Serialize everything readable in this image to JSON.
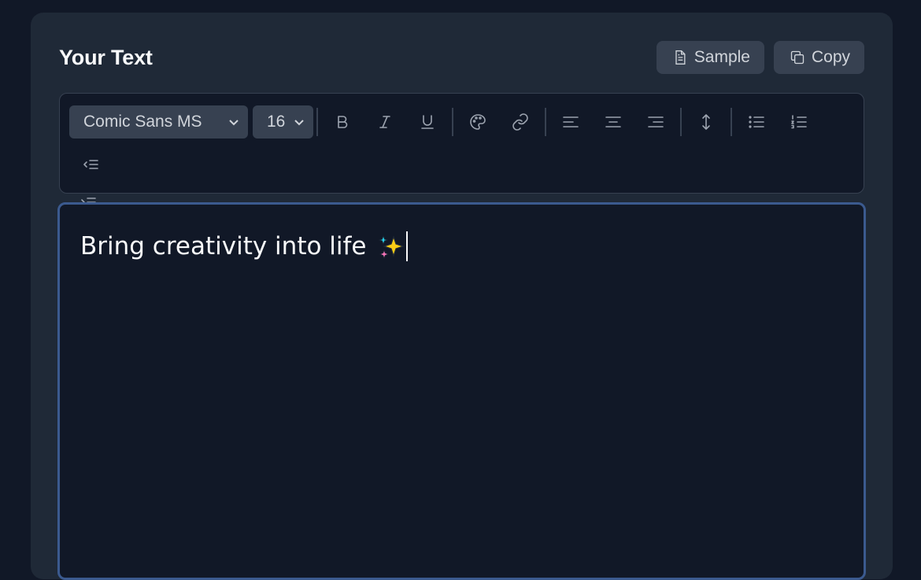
{
  "header": {
    "title": "Your Text",
    "sample_label": "Sample",
    "copy_label": "Copy"
  },
  "toolbar": {
    "font_family": "Comic Sans MS",
    "font_size": "16",
    "buttons": [
      "bold-icon",
      "italic-icon",
      "underline-icon",
      "palette-icon",
      "link-icon",
      "align-left-icon",
      "align-center-icon",
      "align-right-icon",
      "line-height-icon",
      "bullet-list-icon",
      "numbered-list-icon",
      "outdent-icon",
      "indent-icon"
    ]
  },
  "editor": {
    "text": "Bring creativity into life",
    "emoji": "sparkles-icon"
  },
  "colors": {
    "background": "#111827",
    "panel": "#1f2937",
    "button": "#374151",
    "editor_focus_border": "#3b5a8f"
  }
}
